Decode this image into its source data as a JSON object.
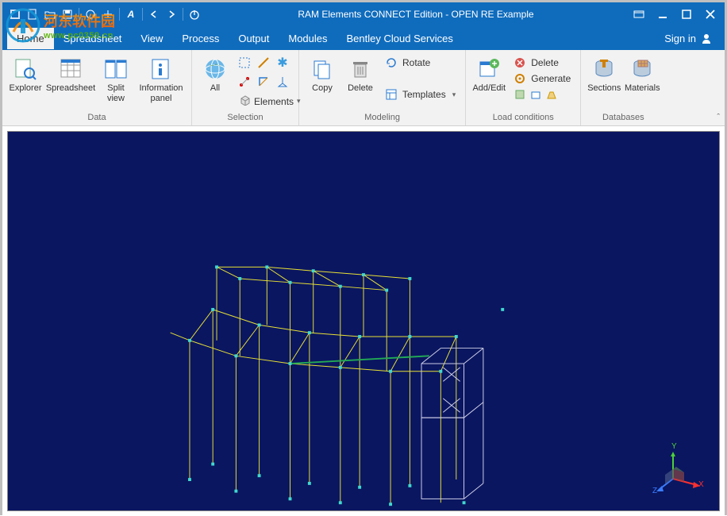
{
  "title": "RAM Elements CONNECT Edition - OPEN RE Example",
  "menu": {
    "items": [
      "Home",
      "Spreadsheet",
      "View",
      "Process",
      "Output",
      "Modules",
      "Bentley Cloud Services"
    ],
    "active": "Home",
    "signin": "Sign in"
  },
  "ribbon": {
    "groups": {
      "data": {
        "label": "Data",
        "explorer": "Explorer",
        "spreadsheet": "Spreadsheet",
        "splitview": "Split\nview",
        "infopanel": "Information\npanel"
      },
      "selection": {
        "label": "Selection",
        "all": "All",
        "elements": "Elements"
      },
      "modeling": {
        "label": "Modeling",
        "copy": "Copy",
        "delete": "Delete",
        "rotate": "Rotate",
        "templates": "Templates"
      },
      "loads": {
        "label": "Load conditions",
        "addedit": "Add/Edit",
        "delete": "Delete",
        "generate": "Generate"
      },
      "databases": {
        "label": "Databases",
        "sections": "Sections",
        "materials": "Materials"
      }
    }
  },
  "axis": {
    "x": "X",
    "y": "Y",
    "z": "Z"
  },
  "watermark": {
    "cn": "河东软件园",
    "url": "www.pc0359.cn"
  }
}
